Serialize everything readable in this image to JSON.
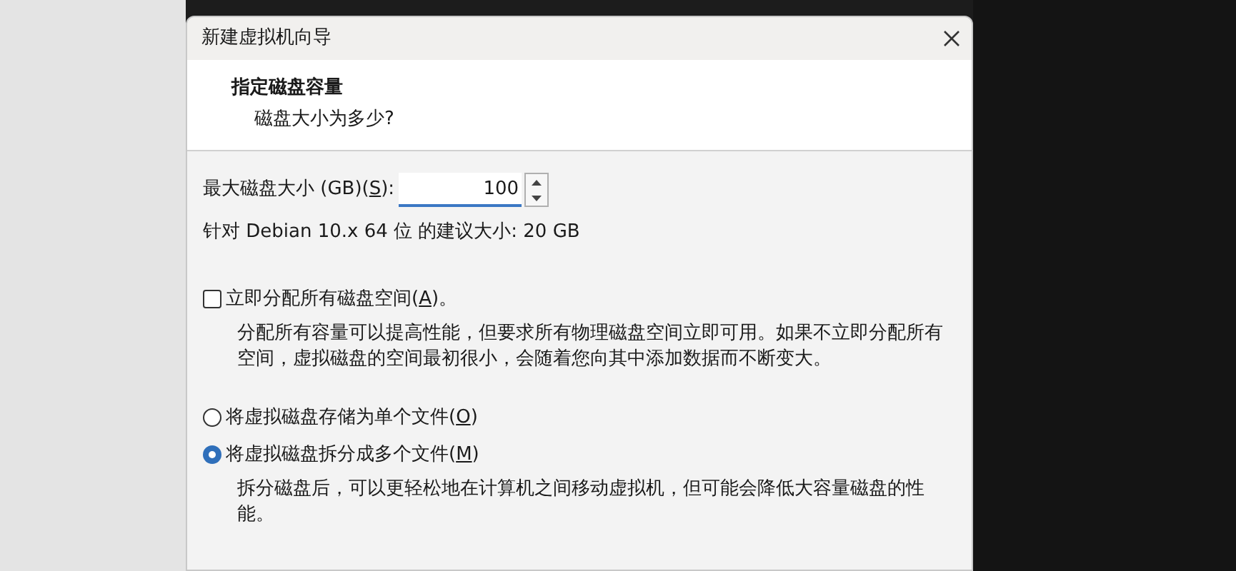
{
  "window": {
    "title": "新建虚拟机向导"
  },
  "header": {
    "title": "指定磁盘容量",
    "subtitle": "磁盘大小为多少?"
  },
  "disk_size": {
    "label": "最大磁盘大小 (GB)(",
    "access_key": "S",
    "label_end": "):",
    "value": "100"
  },
  "recommendation": "针对 Debian 10.x 64 位 的建议大小: 20 GB",
  "allocate": {
    "label": "立即分配所有磁盘空间(",
    "access_key": "A",
    "label_end": ")。",
    "checked": false,
    "description": "分配所有容量可以提高性能，但要求所有物理磁盘空间立即可用。如果不立即分配所有空间，虚拟磁盘的空间最初很小，会随着您向其中添加数据而不断变大。"
  },
  "storage_options": [
    {
      "label": "将虚拟磁盘存储为单个文件(",
      "access_key": "O",
      "label_end": ")",
      "selected": false
    },
    {
      "label": "将虚拟磁盘拆分成多个文件(",
      "access_key": "M",
      "label_end": ")",
      "selected": true,
      "description": "拆分磁盘后，可以更轻松地在计算机之间移动虚拟机，但可能会降低大容量磁盘的性能。"
    }
  ]
}
